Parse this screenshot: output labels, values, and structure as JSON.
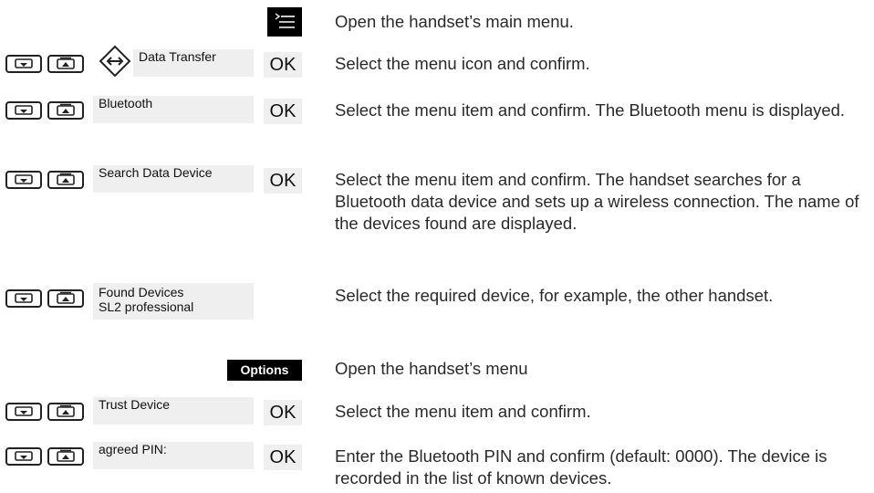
{
  "icons": {
    "key_down": "nav-down-key-icon",
    "key_up": "nav-up-key-icon",
    "main_menu": "main-menu-icon",
    "data_transfer": "data-transfer-icon"
  },
  "rows": {
    "menu": {
      "desc": "Open the handset’s main menu."
    },
    "data_transfer": {
      "display": "Data Transfer",
      "ok": "OK",
      "desc": "Select the menu icon and confirm."
    },
    "bluetooth": {
      "display": "Bluetooth",
      "ok": "OK",
      "desc": "Select the menu item and confirm. The Bluetooth menu is displayed."
    },
    "search": {
      "display": "Search Data Device",
      "ok": "OK",
      "desc": "Select the menu item and confirm. The handset searches for a Bluetooth data device and sets up a wireless connection. The name of the devices found are displayed."
    },
    "found": {
      "display_line1": "Found Devices",
      "display_line2": "SL2 professional",
      "desc": "Select the required device, for example, the other handset."
    },
    "options": {
      "button": "Options",
      "desc": "Open the handset’s menu"
    },
    "trust": {
      "display": "Trust Device",
      "ok": "OK",
      "desc": "Select the menu item and confirm."
    },
    "pin": {
      "display": "agreed PIN:",
      "ok": "OK",
      "desc": "Enter the Bluetooth PIN and confirm (default: 0000). The device is recorded in the list of known devices."
    }
  }
}
